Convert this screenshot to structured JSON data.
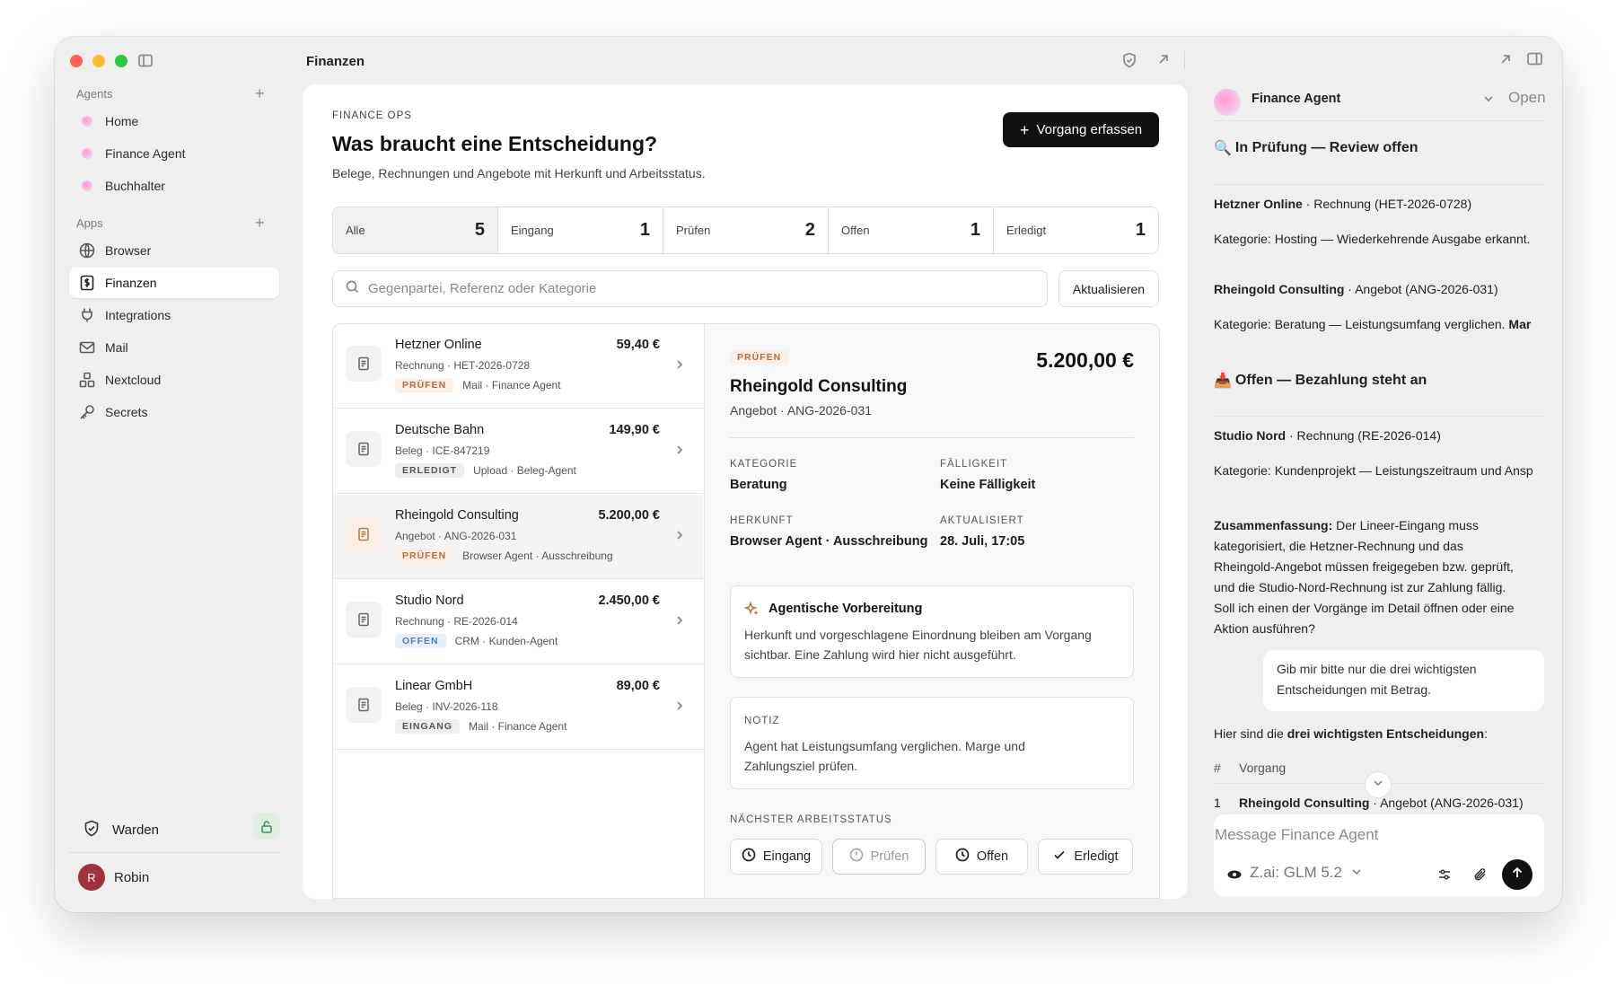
{
  "window": {
    "title": "Finanzen"
  },
  "sidebar": {
    "agents_label": "Agents",
    "agents": [
      "Home",
      "Finance Agent",
      "Buchhalter"
    ],
    "apps_label": "Apps",
    "apps": [
      {
        "label": "Browser",
        "icon": "globe-icon"
      },
      {
        "label": "Finanzen",
        "icon": "finance-icon"
      },
      {
        "label": "Integrations",
        "icon": "plug-icon"
      },
      {
        "label": "Mail",
        "icon": "mail-icon"
      },
      {
        "label": "Nextcloud",
        "icon": "nextcloud-icon"
      },
      {
        "label": "Secrets",
        "icon": "key-icon"
      }
    ],
    "warden_label": "Warden",
    "user": {
      "initial": "R",
      "name": "Robin",
      "avatar_color": "#a0323e"
    }
  },
  "main": {
    "eyebrow": "FINANCE OPS",
    "title": "Was braucht eine Entscheidung?",
    "subtitle": "Belege, Rechnungen und Angebote mit Herkunft und Arbeitsstatus.",
    "new_button": "Vorgang erfassen",
    "filters": [
      {
        "label": "Alle",
        "count": "5"
      },
      {
        "label": "Eingang",
        "count": "1"
      },
      {
        "label": "Prüfen",
        "count": "2"
      },
      {
        "label": "Offen",
        "count": "1"
      },
      {
        "label": "Erledigt",
        "count": "1"
      }
    ],
    "search_placeholder": "Gegenpartei, Referenz oder Kategorie",
    "refresh_label": "Aktualisieren",
    "items": [
      {
        "name": "Hetzner Online",
        "amount": "59,40 €",
        "sub": "Rechnung · HET-2026-0728",
        "status": "PRÜFEN",
        "source": "Mail · Finance Agent"
      },
      {
        "name": "Deutsche Bahn",
        "amount": "149,90 €",
        "sub": "Beleg · ICE-847219",
        "status": "ERLEDIGT",
        "source": "Upload · Beleg-Agent"
      },
      {
        "name": "Rheingold Consulting",
        "amount": "5.200,00 €",
        "sub": "Angebot · ANG-2026-031",
        "status": "PRÜFEN",
        "source": "Browser Agent · Ausschreibung"
      },
      {
        "name": "Studio Nord",
        "amount": "2.450,00 €",
        "sub": "Rechnung · RE-2026-014",
        "status": "OFFEN",
        "source": "CRM · Kunden-Agent"
      },
      {
        "name": "Linear GmbH",
        "amount": "89,00 €",
        "sub": "Beleg · INV-2026-118",
        "status": "EINGANG",
        "source": "Mail · Finance Agent"
      }
    ],
    "detail": {
      "status": "PRÜFEN",
      "amount": "5.200,00 €",
      "name": "Rheingold Consulting",
      "sub": "Angebot · ANG-2026-031",
      "kategorie_label": "KATEGORIE",
      "kategorie": "Beratung",
      "faelligkeit_label": "FÄLLIGKEIT",
      "faelligkeit": "Keine Fälligkeit",
      "herkunft_label": "HERKUNFT",
      "herkunft": "Browser Agent · Ausschreibung",
      "aktualisiert_label": "AKTUALISIERT",
      "aktualisiert": "28. Juli, 17:05",
      "prep_title": "Agentische Vorbereitung",
      "prep_text_1": "Herkunft und vorgeschlagene Einordnung bleiben am Vorgang",
      "prep_text_2": "sichtbar. Eine Zahlung wird hier nicht ausgeführt.",
      "note_label": "NOTIZ",
      "note_text_1": "Agent hat Leistungsumfang verglichen. Marge und",
      "note_text_2": "Zahlungsziel prüfen.",
      "next_label": "NÄCHSTER ARBEITSSTATUS",
      "status_buttons": [
        "Eingang",
        "Prüfen",
        "Offen",
        "Erledigt"
      ]
    }
  },
  "chat": {
    "agent_name": "Finance Agent",
    "open_label": "Open",
    "section1_title": "In Prüfung — Review offen",
    "item1_name": "Hetzner Online",
    "item1_rest": " · Rechnung (HET-2026-0728)",
    "item1_cat": "Kategorie: Hosting — Wiederkehrende Ausgabe erkannt.",
    "item2_name": "Rheingold Consulting",
    "item2_rest": " · Angebot (ANG-2026-031)",
    "item2_cat": "Kategorie: Beratung — Leistungsumfang verglichen.",
    "item2_cat_bold": "Mar",
    "section2_title": "Offen — Bezahlung steht an",
    "item3_name": "Studio Nord",
    "item3_rest": " · Rechnung (RE-2026-014)",
    "item3_cat": "Kategorie: Kundenprojekt — Leistungszeitraum und Ansp",
    "summary_label": "Zusammenfassung:",
    "summary_lines": [
      " Der Lineer-Eingang muss",
      "kategorisiert, die Hetzner-Rechnung und das",
      "Rheingold-Angebot müssen freigegeben bzw. geprüft,",
      "und die Studio-Nord-Rechnung ist zur Zahlung fällig.",
      "Soll ich einen der Vorgänge im Detail öffnen oder eine",
      "Aktion ausführen?"
    ],
    "user_msg_1": "Gib mir bitte nur die drei wichtigsten",
    "user_msg_2": "Entscheidungen mit Betrag.",
    "reply_prefix": "Hier sind die ",
    "reply_bold": "drei wichtigsten Entscheidungen",
    "reply_suffix": ":",
    "table_hash": "#",
    "table_col": "Vorgang",
    "table_row_num": "1",
    "table_row_name": "Rheingold Consulting",
    "table_row_rest": " · Angebot (ANG-2026-031)",
    "input_placeholder": "Message Finance Agent",
    "model_label": "Z.ai: GLM 5.2"
  }
}
